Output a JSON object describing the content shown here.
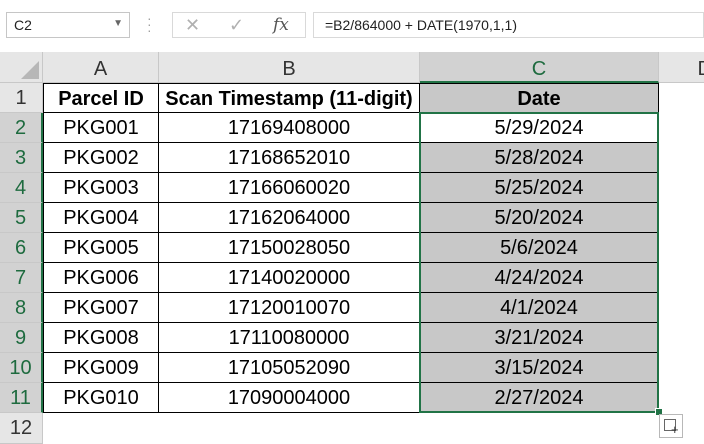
{
  "formula_bar": {
    "name_box": "C2",
    "cancel_icon": "✕",
    "enter_icon": "✓",
    "fx_label": "fx",
    "formula": "=B2/864000 + DATE(1970,1,1)"
  },
  "columns": [
    "A",
    "B",
    "C"
  ],
  "next_column_partial": "D",
  "row_numbers": [
    "1",
    "2",
    "3",
    "4",
    "5",
    "6",
    "7",
    "8",
    "9",
    "10",
    "11",
    "12"
  ],
  "header_row": {
    "a": "Parcel ID",
    "b": "Scan Timestamp (11-digit)",
    "c": "Date"
  },
  "rows": [
    {
      "id": "PKG001",
      "ts": "17169408000",
      "date": "5/29/2024"
    },
    {
      "id": "PKG002",
      "ts": "17168652010",
      "date": "5/28/2024"
    },
    {
      "id": "PKG003",
      "ts": "17166060020",
      "date": "5/25/2024"
    },
    {
      "id": "PKG004",
      "ts": "17162064000",
      "date": "5/20/2024"
    },
    {
      "id": "PKG005",
      "ts": "17150028050",
      "date": "5/6/2024"
    },
    {
      "id": "PKG006",
      "ts": "17140020000",
      "date": "4/24/2024"
    },
    {
      "id": "PKG007",
      "ts": "17120010070",
      "date": "4/1/2024"
    },
    {
      "id": "PKG008",
      "ts": "17110080000",
      "date": "3/21/2024"
    },
    {
      "id": "PKG009",
      "ts": "17105052090",
      "date": "3/15/2024"
    },
    {
      "id": "PKG010",
      "ts": "17090004000",
      "date": "2/27/2024"
    }
  ],
  "selected_range": "C2:C11",
  "colors": {
    "selection_green": "#217346",
    "header_gray": "#e6e6e6",
    "selected_header": "#d2d2d2",
    "cell_shade": "#c8c8c8"
  }
}
